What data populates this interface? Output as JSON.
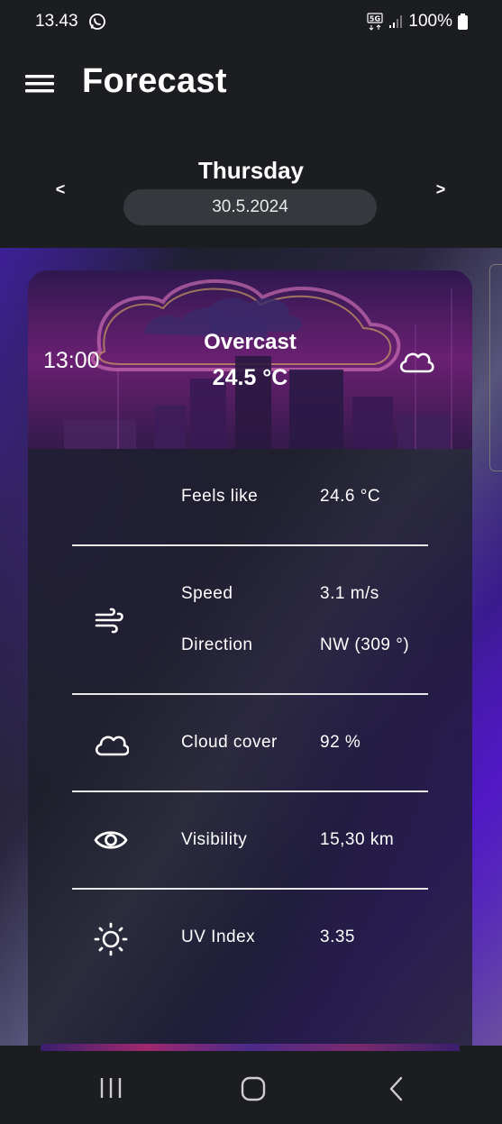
{
  "status_bar": {
    "time": "13.43",
    "network": "5G",
    "battery": "100%"
  },
  "app_bar": {
    "title": "Forecast",
    "menu_icon": "hamburger-menu-icon"
  },
  "date_nav": {
    "day": "Thursday",
    "date": "30.5.2024",
    "prev_label": "<",
    "next_label": ">"
  },
  "card": {
    "time": "13:00",
    "condition": "Overcast",
    "temperature": "24.5 °C",
    "condition_icon": "cloud-icon",
    "rows": [
      {
        "label": "Feels like",
        "value": "24.6 °C"
      },
      {
        "label": "Speed",
        "value": "3.1 m/s",
        "icon": "wind-icon"
      },
      {
        "label": "Direction",
        "value": "NW (309 °)"
      },
      {
        "label": "Cloud cover",
        "value": "92 %",
        "icon": "cloud-icon"
      },
      {
        "label": "Visibility",
        "value": "15,30 km",
        "icon": "eye-icon"
      },
      {
        "label": "UV Index",
        "value": "3.35",
        "icon": "sun-icon"
      }
    ]
  },
  "colors": {
    "background": "#1b1d20",
    "pill": "#35383d",
    "accent_purple": "#4b1bbd"
  },
  "nav_bar": {
    "icons": [
      "recents-icon",
      "home-icon",
      "back-icon"
    ]
  }
}
